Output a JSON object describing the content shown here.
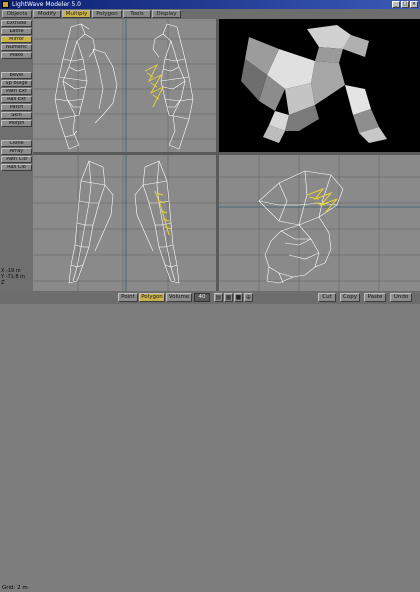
{
  "window": {
    "title": "LightWave Modeler 5.0",
    "minimize_glyph": "_",
    "maximize_glyph": "□",
    "close_glyph": "×"
  },
  "tabs": [
    {
      "label": "Objects",
      "active": false
    },
    {
      "label": "Modify",
      "active": false
    },
    {
      "label": "Multiply",
      "active": true
    },
    {
      "label": "Polygon",
      "active": false
    },
    {
      "label": "Tools",
      "active": false
    },
    {
      "label": "Display",
      "active": false
    }
  ],
  "tools": [
    {
      "label": "Extrude",
      "active": false
    },
    {
      "label": "Lathe",
      "active": false
    },
    {
      "label": "Mirror",
      "active": true
    },
    {
      "label": "Numeric",
      "active": false
    },
    {
      "label": "Make",
      "active": false
    },
    {
      "label": "Bevel",
      "active": false
    },
    {
      "label": "Sp Bulge",
      "active": false
    },
    {
      "label": "Path Ext",
      "active": false
    },
    {
      "label": "Rail Ext",
      "active": false
    },
    {
      "label": "Patch",
      "active": false
    },
    {
      "label": "Skin",
      "active": false
    },
    {
      "label": "Morph",
      "active": false
    },
    {
      "label": "Clone",
      "active": false
    },
    {
      "label": "Array",
      "active": false
    },
    {
      "label": "Path Clo",
      "active": false
    },
    {
      "label": "Rail Clo",
      "active": false
    }
  ],
  "coords": {
    "x": "X -19 m",
    "y": "Y -71.8 m",
    "z": "Z"
  },
  "status": {
    "grid": "Grid: 2 m",
    "point": "Point",
    "polygon": "Polygon",
    "volume": "Volume",
    "count": "40",
    "cut": "Cut",
    "copy": "Copy",
    "paste": "Paste",
    "undo": "Undo"
  },
  "icons": {
    "layers": "layers-icon",
    "wireframe": "wireframe-icon",
    "shaded": "shaded-icon",
    "zoom": "zoom-icon"
  },
  "colors": {
    "selection": "#e8d23a",
    "wire": "#ffffff",
    "viewport_bg": "#8a8a8a",
    "active_button": "#c9b24a"
  }
}
